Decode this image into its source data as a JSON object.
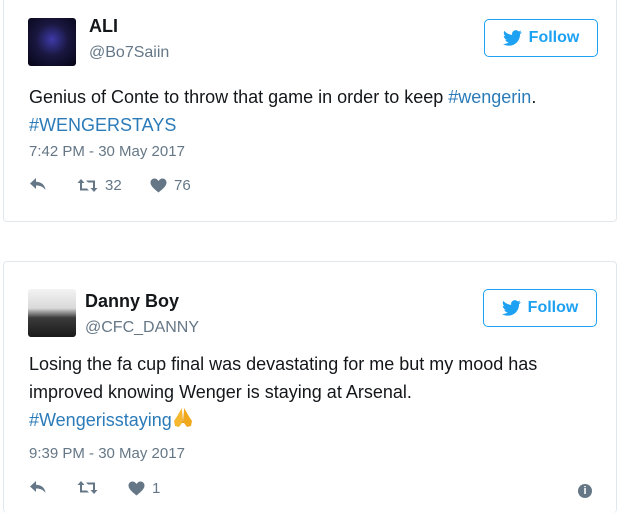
{
  "tweets": [
    {
      "name": "ALI",
      "handle": "@Bo7Saiin",
      "follow_label": "Follow",
      "text_plain": "Genius of Conte to throw that game in order to keep ",
      "hashtag_inline": "#wengerin",
      "text_after": ".",
      "hashtag_line2": "#WENGERSTAYS",
      "timestamp": "7:42 PM - 30 May 2017",
      "retweets": "32",
      "likes": "76"
    },
    {
      "name": "Danny Boy",
      "handle": "@CFC_DANNY",
      "follow_label": "Follow",
      "text_line1": "Losing the fa cup final was devastating for me but my mood has",
      "text_line2": "improved knowing Wenger is staying at Arsenal.",
      "hashtag": "#Wengerisstaying",
      "emoji_icon": "folded-hands-icon",
      "timestamp": "9:39 PM - 30 May 2017",
      "retweets": "",
      "likes": "1"
    }
  ],
  "colors": {
    "accent": "#1da1f2",
    "hashtag": "#2b7bb9",
    "muted": "#657786",
    "border": "#e1e8ed"
  }
}
